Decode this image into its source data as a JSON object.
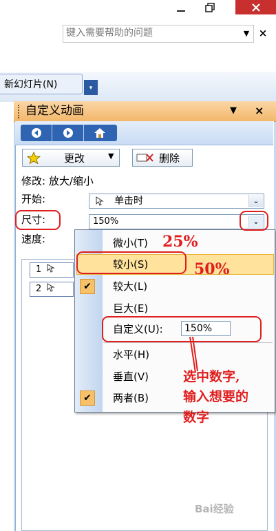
{
  "window": {
    "minimize_icon": "minimize-icon",
    "restore_icon": "restore-icon",
    "close_icon": "close-icon"
  },
  "help": {
    "placeholder": "键入需要帮助的问题"
  },
  "toolbar": {
    "new_slide_label": "新幻灯片(N)"
  },
  "task_pane": {
    "title": "自定义动画",
    "modify_label": "更改",
    "delete_label": "删除",
    "modify_info": "修改: 放大/缩小",
    "start_label": "开始:",
    "start_value": "单击时",
    "size_label": "尺寸:",
    "size_value": "150%",
    "speed_label": "速度:",
    "list_items": [
      "1",
      "2"
    ]
  },
  "size_menu": {
    "items": [
      {
        "label": "微小(T)",
        "checked": false
      },
      {
        "label": "较小(S)",
        "checked": false,
        "highlighted": true
      },
      {
        "label": "较大(L)",
        "checked": true
      },
      {
        "label": "巨大(E)",
        "checked": false
      },
      {
        "label": "自定义(U):",
        "checked": false
      }
    ],
    "custom_value": "150%",
    "direction_items": [
      {
        "label": "水平(H)",
        "checked": false
      },
      {
        "label": "垂直(V)",
        "checked": false
      },
      {
        "label": "两者(B)",
        "checked": true
      }
    ]
  },
  "annotations": {
    "pct_25": "25%",
    "pct_50": "50%",
    "note_line1": "选中数字,",
    "note_line2": "输入想要的",
    "note_line3": "数字"
  },
  "watermark": "Bai经验",
  "colors": {
    "annotation_red": "#e01e1e",
    "pane_header": "#f3b76a",
    "highlight": "#ffe39d",
    "close_red": "#c7302e"
  }
}
